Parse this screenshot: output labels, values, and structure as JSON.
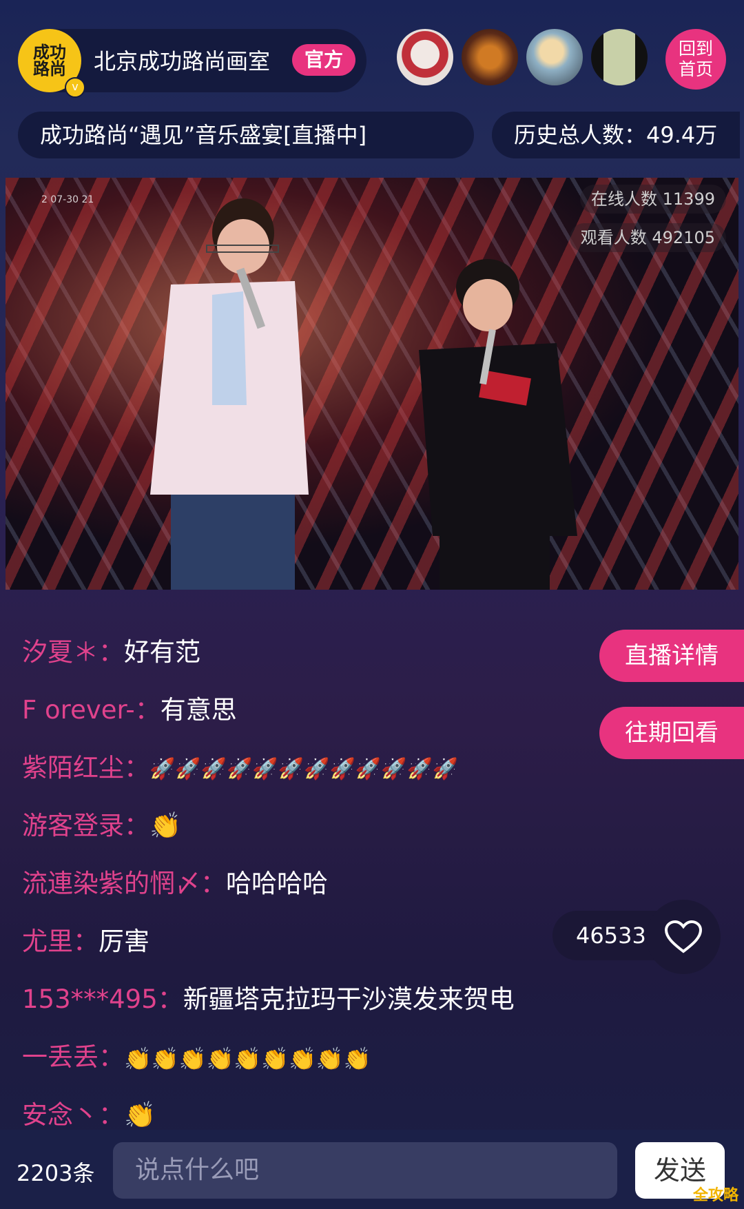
{
  "header": {
    "logo_text": "成功\n路尚",
    "host_name": "北京成功路尚画室",
    "official_badge": "官方",
    "home_button": [
      "回到",
      "首页"
    ],
    "live_title": "成功路尚“遇见”音乐盛宴[直播中]",
    "history_total": "历史总人数：49.4万"
  },
  "video": {
    "timestamp": "2   07-30 21",
    "online_count": "在线人数 11399",
    "view_count": "观看人数 492105"
  },
  "side_buttons": {
    "live_details": "直播详情",
    "past_replays": "往期回看"
  },
  "chat": [
    {
      "user": "汐夏＊：",
      "msg": "好有范"
    },
    {
      "user": "F orever-：",
      "msg": "有意思"
    },
    {
      "user": "紫陌红尘：",
      "msg": "🚀🚀🚀🚀🚀🚀🚀🚀🚀🚀🚀🚀"
    },
    {
      "user": "游客登录：",
      "msg": "👏"
    },
    {
      "user": "流連染紫的惘〆：",
      "msg": "哈哈哈哈"
    },
    {
      "user": "尤里：",
      "msg": "厉害"
    },
    {
      "user": "153***495：",
      "msg": "新疆塔克拉玛干沙漠发来贺电"
    },
    {
      "user": "一丢丢：",
      "msg": "👏👏👏👏👏👏👏👏👏"
    },
    {
      "user": "安念丶：",
      "msg": "👏"
    }
  ],
  "likes": "46533",
  "footer": {
    "message_count": "2203条",
    "input_placeholder": "说点什么吧",
    "send_label": "发送"
  },
  "watermark": "全攻略",
  "colors": {
    "accent": "#e8337f",
    "username": "#e0428c",
    "pill_bg": "#141a3e"
  }
}
